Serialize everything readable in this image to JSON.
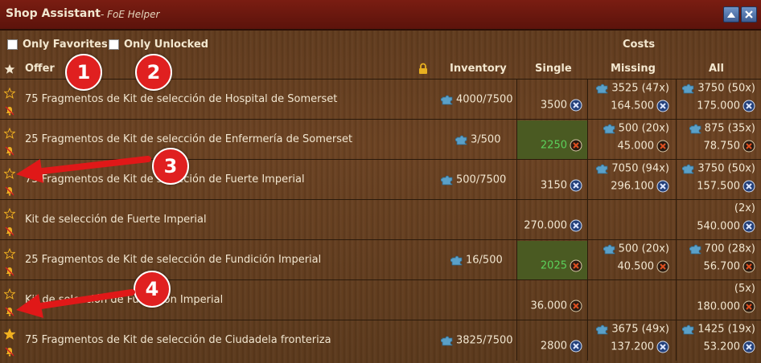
{
  "window": {
    "title": "Shop Assistant",
    "subtitle": "- FoE Helper"
  },
  "filters": {
    "only_favorites_label": "Only Favorites",
    "only_unlocked_label": "Only Unlocked"
  },
  "columns": {
    "costs": "Costs",
    "offer": "Offer",
    "inventory": "Inventory",
    "single": "Single",
    "missing": "Missing",
    "all": "All"
  },
  "annotations": [
    "1",
    "2",
    "3",
    "4"
  ],
  "rows": [
    {
      "offer": "75 Fragmentos de Kit de selección de Hospital de Somerset",
      "inventory": "4000/7500",
      "single": "3500",
      "single_coin": "blue",
      "single_green": false,
      "missing_top": "3525 (47x)",
      "missing_bottom": "164.500",
      "missing_coin": "blue",
      "all_top": "3750 (50x)",
      "all_bottom": "175.000",
      "all_coin": "blue",
      "fav": false
    },
    {
      "offer": "25 Fragmentos de Kit de selección de Enfermería de Somerset",
      "inventory": "3/500",
      "single": "2250",
      "single_coin": "brown",
      "single_green": true,
      "missing_top": "500 (20x)",
      "missing_bottom": "45.000",
      "missing_coin": "brown",
      "all_top": "875 (35x)",
      "all_bottom": "78.750",
      "all_coin": "brown",
      "fav": false
    },
    {
      "offer": "75 Fragmentos de Kit de selección de Fuerte Imperial",
      "inventory": "500/7500",
      "single": "3150",
      "single_coin": "blue",
      "single_green": false,
      "missing_top": "7050 (94x)",
      "missing_bottom": "296.100",
      "missing_coin": "blue",
      "all_top": "3750 (50x)",
      "all_bottom": "157.500",
      "all_coin": "blue",
      "fav": false
    },
    {
      "offer": "Kit de selección de Fuerte Imperial",
      "inventory": "",
      "single": "270.000",
      "single_coin": "blue",
      "single_green": false,
      "missing_top": "",
      "missing_bottom": "",
      "missing_coin": "",
      "all_top": "(2x)",
      "all_bottom": "540.000",
      "all_coin": "blue",
      "fav": false
    },
    {
      "offer": "25 Fragmentos de Kit de selección de Fundición Imperial",
      "inventory": "16/500",
      "single": "2025",
      "single_coin": "brown",
      "single_green": true,
      "missing_top": "500 (20x)",
      "missing_bottom": "40.500",
      "missing_coin": "brown",
      "all_top": "700 (28x)",
      "all_bottom": "56.700",
      "all_coin": "brown",
      "fav": false
    },
    {
      "offer": "Kit de selección de Fundición Imperial",
      "inventory": "",
      "single": "36.000",
      "single_coin": "brown",
      "single_green": false,
      "missing_top": "",
      "missing_bottom": "",
      "missing_coin": "",
      "all_top": "(5x)",
      "all_bottom": "180.000",
      "all_coin": "brown",
      "fav": false
    },
    {
      "offer": "75 Fragmentos de Kit de selección de Ciudadela fronteriza",
      "inventory": "3825/7500",
      "single": "2800",
      "single_coin": "blue",
      "single_green": false,
      "missing_top": "3675 (49x)",
      "missing_bottom": "137.200",
      "missing_coin": "blue",
      "all_top": "1425 (19x)",
      "all_bottom": "53.200",
      "all_coin": "blue",
      "fav": true
    }
  ],
  "colors": {
    "titlebar": "#6b170d",
    "text": "#f1e6d0",
    "green_text": "#5bd05b",
    "annotation": "#e02020"
  }
}
